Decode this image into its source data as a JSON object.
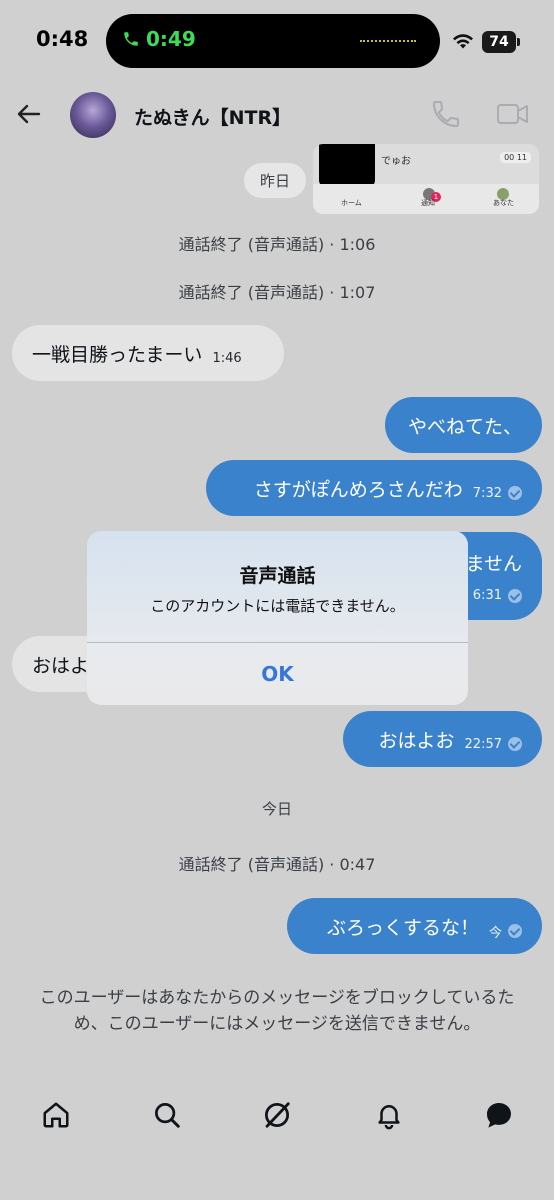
{
  "status_bar": {
    "time": "0:48",
    "call_timer": "0:49",
    "battery": "74"
  },
  "header": {
    "title": "たぬきん【NTR】"
  },
  "thumbnail": {
    "text": "でゅお",
    "badge": "00 11",
    "tabs": [
      "ホーム",
      "通知",
      "あなた"
    ],
    "notif_count": "1"
  },
  "messages": {
    "day_yesterday": "昨日",
    "call_end_1": "通話終了 (音声通話) · 1:06",
    "call_end_2": "通話終了 (音声通話) · 1:07",
    "in_1": {
      "text": "一戦目勝ったまーい",
      "time": "1:46"
    },
    "out_1": {
      "text": "やべねてた、"
    },
    "out_2": {
      "text": "さすがぽんめろさんだわ",
      "time": "7:32"
    },
    "out_3": {
      "text": "ません",
      "time": "6:31"
    },
    "in_2": {
      "text": "おはよ"
    },
    "out_4": {
      "text": "おはよお",
      "time": "22:57"
    },
    "day_today": "今日",
    "call_end_3": "通話終了 (音声通話) · 0:47",
    "out_5": {
      "text": "ぶろっくするな！",
      "time": "今"
    }
  },
  "dialog": {
    "title": "音声通話",
    "message": "このアカウントには電話できません。",
    "ok": "OK"
  },
  "notice": "このユーザーはあなたからのメッセージをブロックしているため、このユーザーにはメッセージを送信できません。",
  "nav": {
    "icons": [
      "home-icon",
      "search-icon",
      "grok-icon",
      "bell-icon",
      "messages-icon"
    ]
  },
  "colors": {
    "overlay_bg": "#d0d0d0",
    "outgoing_bubble": "#3b82cc",
    "incoming_bubble": "#e4e4e4",
    "dialog_ok": "#3578d6",
    "call_green": "#3ddc59"
  }
}
